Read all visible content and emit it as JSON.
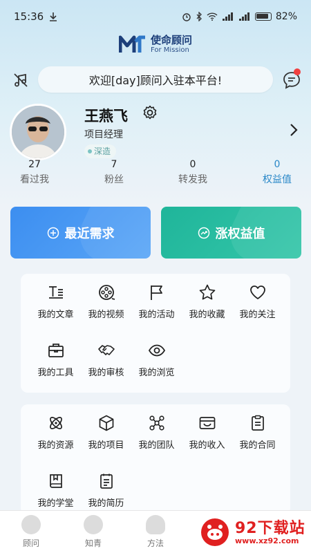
{
  "status_bar": {
    "time": "15:36",
    "battery": "82%"
  },
  "brand": {
    "name_cn": "使命顾问",
    "name_en": "For Mission"
  },
  "welcome": {
    "text": "欢迎[day]顾问入驻本平台!"
  },
  "profile": {
    "name": "王燕飞",
    "role": "项目经理",
    "tag": "深造"
  },
  "stats": [
    {
      "value": "27",
      "label": "看过我"
    },
    {
      "value": "7",
      "label": "粉丝"
    },
    {
      "value": "0",
      "label": "转发我"
    },
    {
      "value": "0",
      "label": "权益值"
    }
  ],
  "actions": {
    "recent": "最近需求",
    "rights": "涨权益值"
  },
  "grid1": [
    {
      "label": "我的文章",
      "icon": "article-icon"
    },
    {
      "label": "我的视频",
      "icon": "film-reel-icon"
    },
    {
      "label": "我的活动",
      "icon": "flag-icon"
    },
    {
      "label": "我的收藏",
      "icon": "star-icon"
    },
    {
      "label": "我的关注",
      "icon": "heart-icon"
    },
    {
      "label": "我的工具",
      "icon": "toolbox-icon"
    },
    {
      "label": "我的审核",
      "icon": "handshake-icon"
    },
    {
      "label": "我的浏览",
      "icon": "eye-icon"
    }
  ],
  "grid2": [
    {
      "label": "我的资源",
      "icon": "atom-icon"
    },
    {
      "label": "我的项目",
      "icon": "box-icon"
    },
    {
      "label": "我的团队",
      "icon": "network-icon"
    },
    {
      "label": "我的收入",
      "icon": "wallet-icon"
    },
    {
      "label": "我的合同",
      "icon": "clipboard-icon"
    },
    {
      "label": "我的学堂",
      "icon": "book-icon"
    },
    {
      "label": "我的简历",
      "icon": "resume-icon"
    }
  ],
  "tabs": [
    {
      "label": "顾问"
    },
    {
      "label": "知青"
    },
    {
      "label": "方法"
    }
  ],
  "watermark": {
    "title": "92下载站",
    "url": "www.xz92.com"
  },
  "colors": {
    "blue_button": "#3c8ef0",
    "green_button": "#1fb59a",
    "highlight": "#2a88c8",
    "badge_red": "#f04040"
  }
}
